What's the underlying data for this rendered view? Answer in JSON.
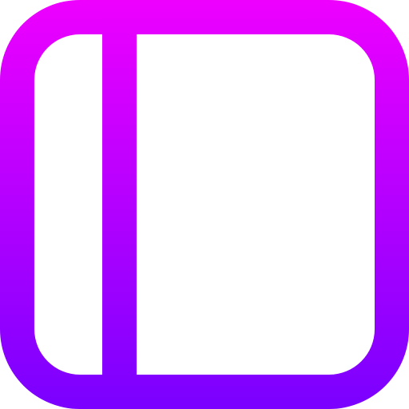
{
  "icon": {
    "name": "sidebar-panel-icon",
    "gradient": {
      "top_color": "#ee00ff",
      "bottom_color": "#7a00ff"
    }
  }
}
